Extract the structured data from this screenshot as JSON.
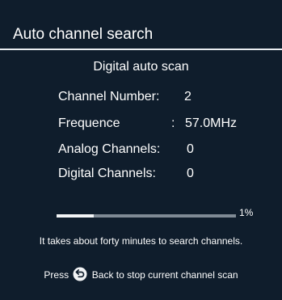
{
  "window": {
    "title": "Auto channel search"
  },
  "scan": {
    "subtitle": "Digital auto scan",
    "fields": [
      {
        "label": "Channel Number:",
        "value": "2"
      },
      {
        "label": "Frequence",
        "separator": ":",
        "value": "57.0MHz"
      },
      {
        "label": "Analog Channels:",
        "value": "0"
      },
      {
        "label": "Digital Channels:",
        "value": "0"
      }
    ],
    "progress_percent": 1,
    "progress_label": "1%",
    "info": "It takes about forty minutes to search channels.",
    "hint_prefix": "Press",
    "hint_icon": "back-icon",
    "hint_suffix": "Back to stop current channel scan"
  },
  "colors": {
    "background": "#0f1d2c",
    "text": "#ffffff",
    "divider": "#e9edf1",
    "progress_track": "#7f8a95",
    "progress_fill": "#f3f5f7"
  }
}
